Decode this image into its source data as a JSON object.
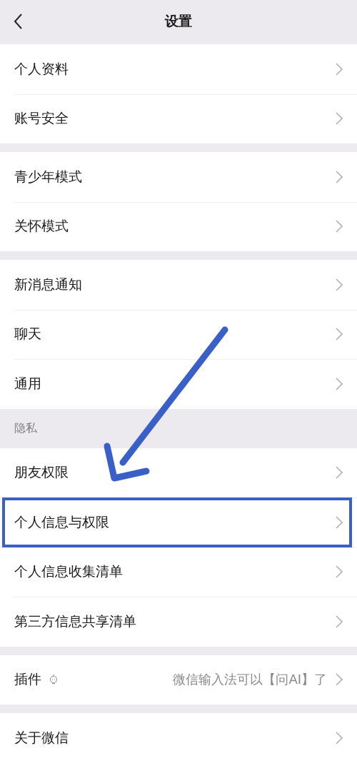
{
  "header": {
    "title": "设置"
  },
  "groups": [
    {
      "items": [
        {
          "label": "个人资料",
          "highlighted": false
        },
        {
          "label": "账号安全",
          "highlighted": false
        }
      ]
    },
    {
      "items": [
        {
          "label": "青少年模式",
          "highlighted": false
        },
        {
          "label": "关怀模式",
          "highlighted": false
        }
      ]
    },
    {
      "items": [
        {
          "label": "新消息通知",
          "highlighted": false
        },
        {
          "label": "聊天",
          "highlighted": false
        },
        {
          "label": "通用",
          "highlighted": false
        }
      ]
    },
    {
      "header": "隐私",
      "items": [
        {
          "label": "朋友权限",
          "highlighted": false
        },
        {
          "label": "个人信息与权限",
          "highlighted": true
        },
        {
          "label": "个人信息收集清单",
          "highlighted": false
        },
        {
          "label": "第三方信息共享清单",
          "highlighted": false
        }
      ]
    },
    {
      "items": [
        {
          "label": "插件",
          "kind": "plugin",
          "value": "微信输入法可以【问AI】了",
          "highlighted": false
        }
      ]
    },
    {
      "items": [
        {
          "label": "关于微信",
          "highlighted": false
        }
      ]
    }
  ]
}
